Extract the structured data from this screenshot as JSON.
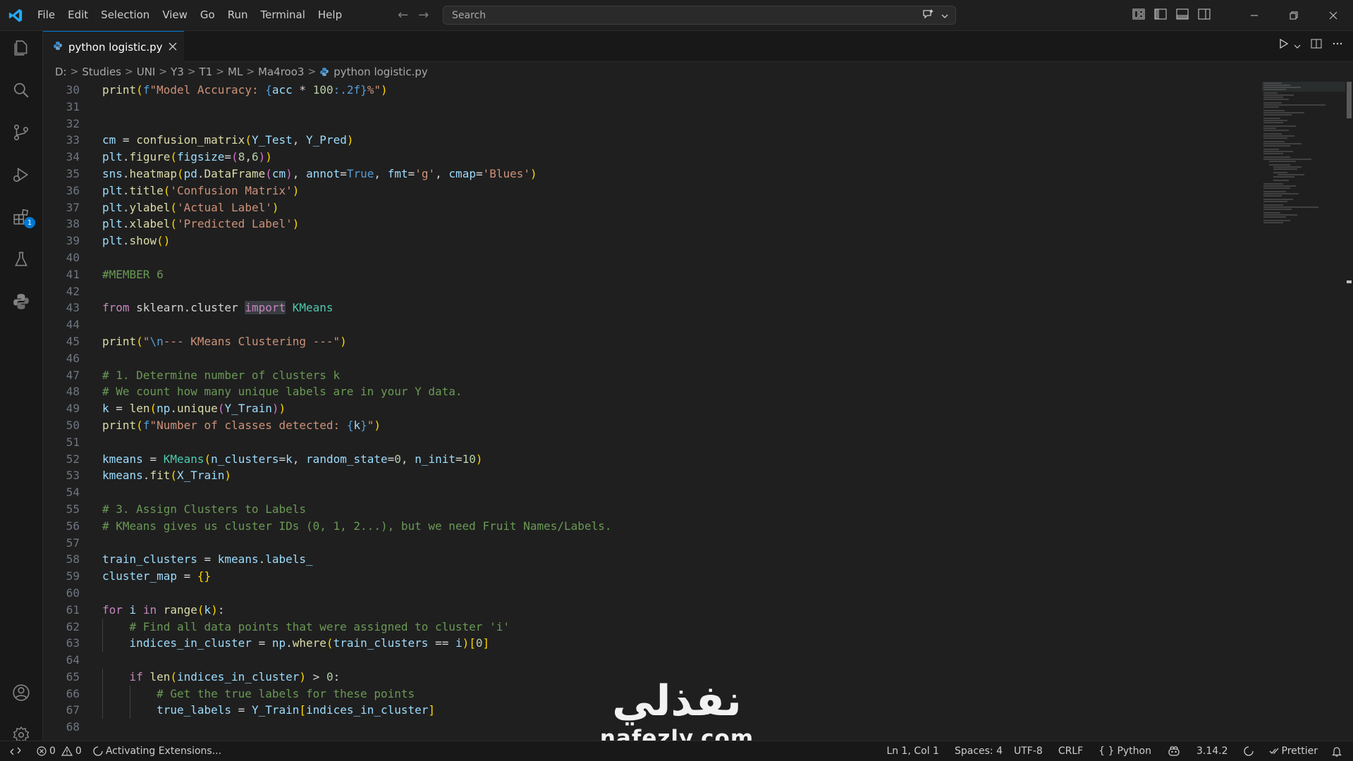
{
  "menu": [
    "File",
    "Edit",
    "Selection",
    "View",
    "Go",
    "Run",
    "Terminal",
    "Help"
  ],
  "search": {
    "placeholder": "Search"
  },
  "tab": {
    "label": "python logistic.py"
  },
  "breadcrumbs": [
    "D:",
    "Studies",
    "UNI",
    "Y3",
    "T1",
    "ML",
    "Ma4roo3",
    "python logistic.py"
  ],
  "activity": {
    "extensions_badge": "1"
  },
  "colors": {
    "accent": "#0078d4",
    "bg": "#1f1f1f",
    "badge": "#0078d4"
  },
  "code": {
    "lines": [
      {
        "n": "30",
        "text": "print(f\"Model Accuracy: {acc * 100:.2f}%\")"
      },
      {
        "n": "31",
        "text": ""
      },
      {
        "n": "32",
        "text": ""
      },
      {
        "n": "33",
        "text": "cm = confusion_matrix(Y_Test, Y_Pred)"
      },
      {
        "n": "34",
        "text": "plt.figure(figsize=(8,6))"
      },
      {
        "n": "35",
        "text": "sns.heatmap(pd.DataFrame(cm), annot=True, fmt='g', cmap='Blues')"
      },
      {
        "n": "36",
        "text": "plt.title('Confusion Matrix')"
      },
      {
        "n": "37",
        "text": "plt.ylabel('Actual Label')"
      },
      {
        "n": "38",
        "text": "plt.xlabel('Predicted Label')"
      },
      {
        "n": "39",
        "text": "plt.show()"
      },
      {
        "n": "40",
        "text": ""
      },
      {
        "n": "41",
        "text": "#MEMBER 6"
      },
      {
        "n": "42",
        "text": ""
      },
      {
        "n": "43",
        "text": "from sklearn.cluster import KMeans"
      },
      {
        "n": "44",
        "text": ""
      },
      {
        "n": "45",
        "text": "print(\"\\n--- KMeans Clustering ---\")"
      },
      {
        "n": "46",
        "text": ""
      },
      {
        "n": "47",
        "text": "# 1. Determine number of clusters k"
      },
      {
        "n": "48",
        "text": "# We count how many unique labels are in your Y data."
      },
      {
        "n": "49",
        "text": "k = len(np.unique(Y_Train))"
      },
      {
        "n": "50",
        "text": "print(f\"Number of classes detected: {k}\")"
      },
      {
        "n": "51",
        "text": ""
      },
      {
        "n": "52",
        "text": "kmeans = KMeans(n_clusters=k, random_state=0, n_init=10)"
      },
      {
        "n": "53",
        "text": "kmeans.fit(X_Train)"
      },
      {
        "n": "54",
        "text": ""
      },
      {
        "n": "55",
        "text": "# 3. Assign Clusters to Labels"
      },
      {
        "n": "56",
        "text": "# KMeans gives us cluster IDs (0, 1, 2...), but we need Fruit Names/Labels."
      },
      {
        "n": "57",
        "text": ""
      },
      {
        "n": "58",
        "text": "train_clusters = kmeans.labels_"
      },
      {
        "n": "59",
        "text": "cluster_map = {}"
      },
      {
        "n": "60",
        "text": ""
      },
      {
        "n": "61",
        "text": "for i in range(k):"
      },
      {
        "n": "62",
        "text": "    # Find all data points that were assigned to cluster 'i'"
      },
      {
        "n": "63",
        "text": "    indices_in_cluster = np.where(train_clusters == i)[0]"
      },
      {
        "n": "64",
        "text": ""
      },
      {
        "n": "65",
        "text": "    if len(indices_in_cluster) > 0:"
      },
      {
        "n": "66",
        "text": "        # Get the true labels for these points"
      },
      {
        "n": "67",
        "text": "        true_labels = Y_Train[indices_in_cluster]"
      },
      {
        "n": "68",
        "text": ""
      }
    ]
  },
  "status": {
    "errors": "0",
    "warnings": "0",
    "activity": "Activating Extensions...",
    "position": "Ln 1, Col 1",
    "spaces": "Spaces: 4",
    "encoding": "UTF-8",
    "eol": "CRLF",
    "language_symbol": "{ }",
    "language": "Python",
    "python_version": "3.14.2",
    "formatter": "Prettier"
  },
  "watermark": {
    "arabic": "نفذلي",
    "latin": "nafezly.com"
  }
}
